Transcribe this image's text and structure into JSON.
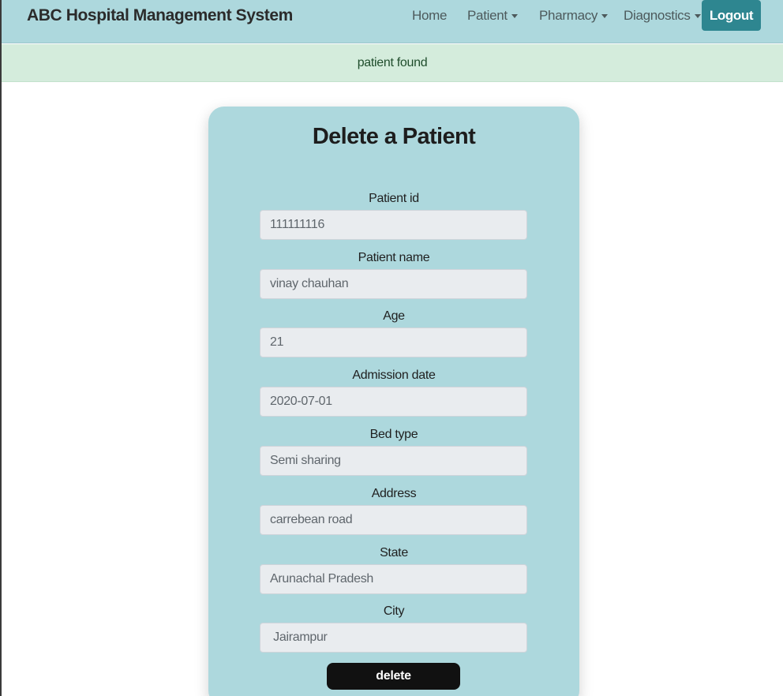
{
  "navbar": {
    "brand": "ABC Hospital Management System",
    "items": [
      {
        "label": "Home",
        "dropdown": false
      },
      {
        "label": "Patient",
        "dropdown": true
      },
      {
        "label": "Pharmacy",
        "dropdown": true
      },
      {
        "label": "Diagnostics",
        "dropdown": true
      }
    ],
    "logout_label": "Logout",
    "colors": {
      "background": "#add8dd",
      "logout": "#2e8690"
    }
  },
  "alert": {
    "message": "patient found",
    "color": "#d4ecdc"
  },
  "form": {
    "title": "Delete a Patient",
    "fields": [
      {
        "label": "Patient id",
        "value": "111111116"
      },
      {
        "label": "Patient name",
        "value": "vinay chauhan"
      },
      {
        "label": "Age",
        "value": "21"
      },
      {
        "label": "Admission date",
        "value": "2020-07-01"
      },
      {
        "label": "Bed type",
        "value": "Semi sharing"
      },
      {
        "label": "Address",
        "value": "carrebean road"
      },
      {
        "label": "State",
        "value": "Arunachal Pradesh"
      },
      {
        "label": "City",
        "value": " Jairampur"
      }
    ],
    "submit_label": "delete"
  }
}
